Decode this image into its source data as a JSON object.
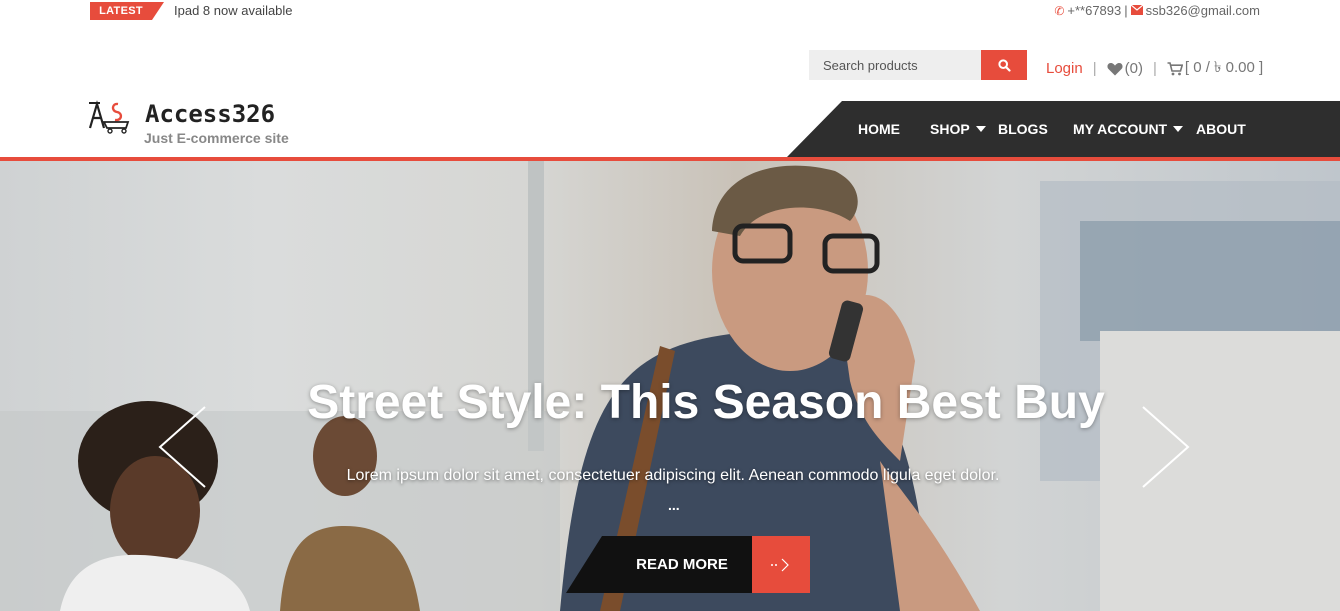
{
  "topbar": {
    "badge": "LATEST",
    "news": "Ipad 8 now available",
    "phone": "+**67893",
    "divider": "|",
    "email": "ssb326@gmail.com"
  },
  "header": {
    "search_placeholder": "Search products",
    "login": "Login",
    "wishlist": "(0)",
    "cart": "[ 0 / ৳ 0.00 ]",
    "sep": "|"
  },
  "logo": {
    "title": "Access326",
    "tagline": "Just E-commerce site"
  },
  "nav": {
    "items": [
      {
        "label": "HOME",
        "dropdown": false
      },
      {
        "label": "SHOP",
        "dropdown": true
      },
      {
        "label": "BLOGS",
        "dropdown": false
      },
      {
        "label": "MY ACCOUNT",
        "dropdown": true
      },
      {
        "label": "ABOUT",
        "dropdown": false
      }
    ]
  },
  "hero": {
    "title": "Street Style: This Season Best Buy",
    "subtitle": "Lorem ipsum dolor sit amet, consectetuer adipiscing elit. Aenean commodo ligula eget dolor.",
    "ellipsis": "...",
    "button": "READ MORE"
  },
  "colors": {
    "accent": "#e74c3c",
    "nav_bg": "#2e2e2e",
    "button_bg": "#111111"
  }
}
